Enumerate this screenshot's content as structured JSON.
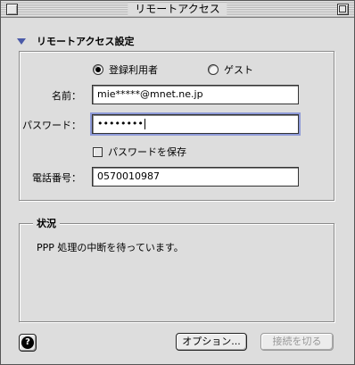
{
  "window": {
    "title": "リモートアクセス"
  },
  "section": {
    "title": "リモートアクセス設定"
  },
  "connection_type": {
    "registered_label": "登録利用者",
    "guest_label": "ゲスト",
    "selected": "registered"
  },
  "form": {
    "name_label": "名前：",
    "name_value": "mie*****@mnet.ne.jp",
    "password_label": "パスワード：",
    "password_value": "••••••••",
    "save_password_label": "パスワードを保存",
    "save_password_checked": false,
    "phone_label": "電話番号：",
    "phone_value": "0570010987"
  },
  "status": {
    "title": "状況",
    "message": "PPP 処理の中断を待っています。"
  },
  "buttons": {
    "help": "?",
    "options": "オプション...",
    "disconnect": "接続を切る"
  }
}
